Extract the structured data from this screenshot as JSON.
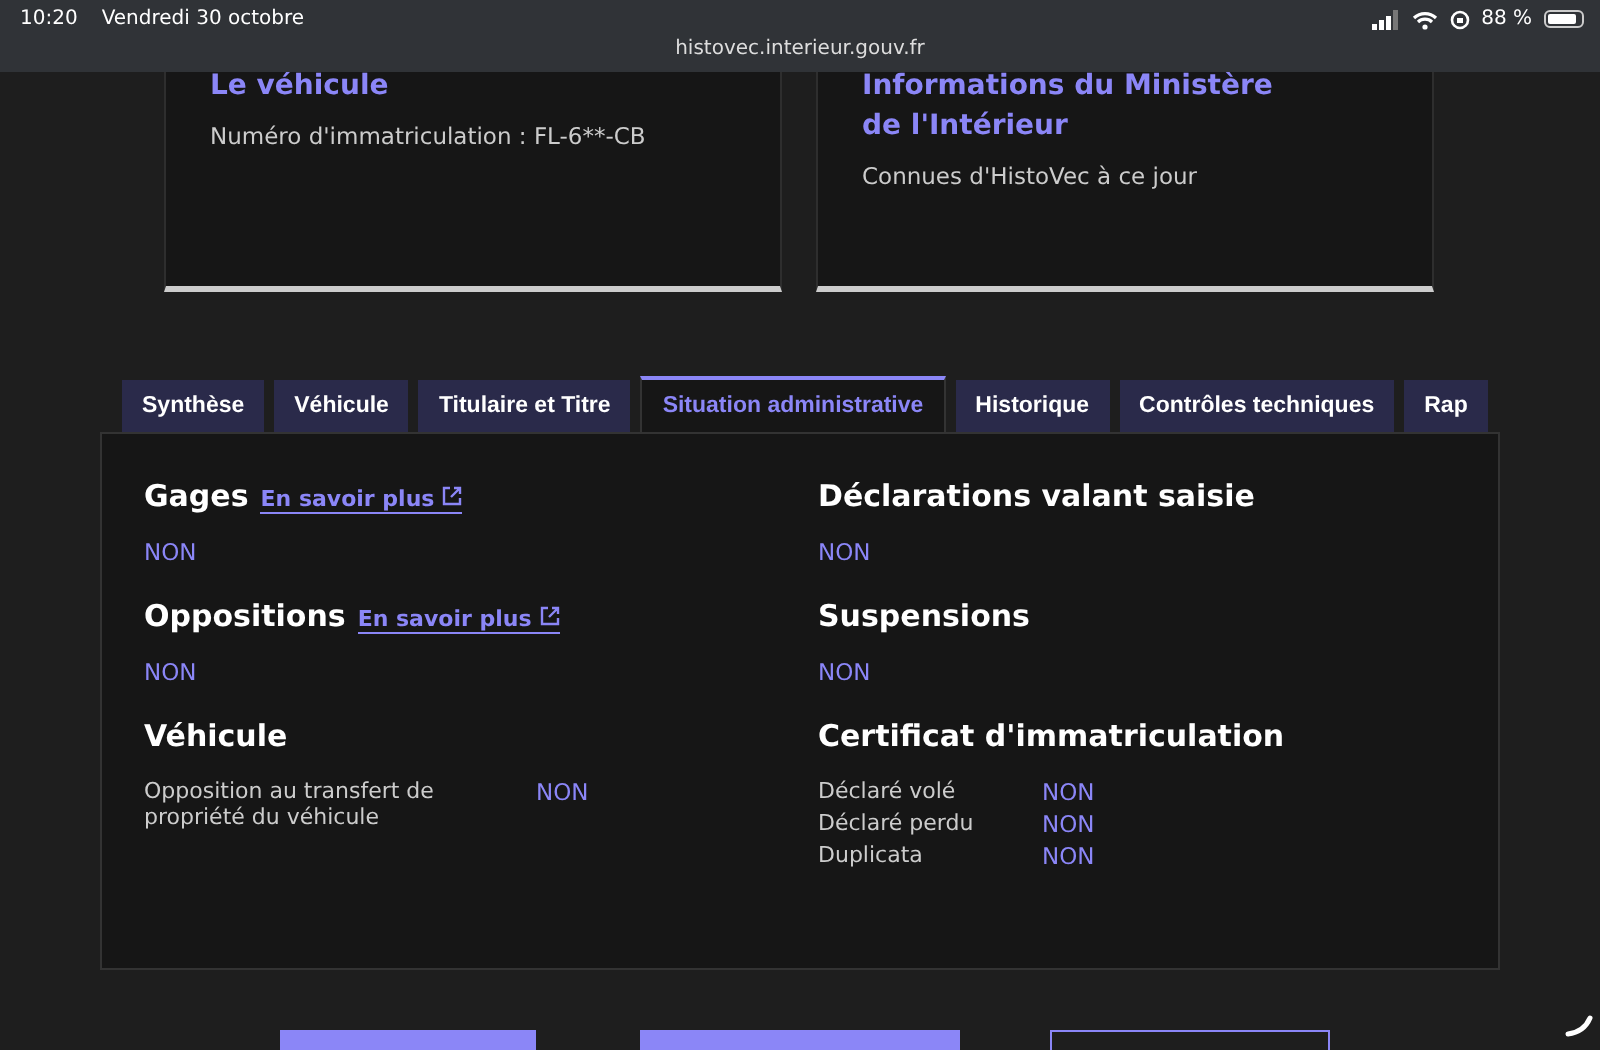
{
  "status_bar": {
    "time": "10:20",
    "date": "Vendredi 30 octobre",
    "url": "histovec.interieur.gouv.fr",
    "battery": "88 %"
  },
  "cards": [
    {
      "title": "Le véhicule",
      "text": "Numéro d'immatriculation : FL-6**-CB"
    },
    {
      "title": "Informations du Ministère de l'Intérieur",
      "text": "Connues d'HistoVec à ce jour"
    }
  ],
  "tabs": [
    {
      "label": "Synthèse",
      "selected": false
    },
    {
      "label": "Véhicule",
      "selected": false
    },
    {
      "label": "Titulaire et Titre",
      "selected": false
    },
    {
      "label": "Situation administrative",
      "selected": true
    },
    {
      "label": "Historique",
      "selected": false
    },
    {
      "label": "Contrôles techniques",
      "selected": false
    },
    {
      "label": "Rap",
      "selected": false
    }
  ],
  "columns": [
    [
      {
        "kind": "simple",
        "title": "Gages",
        "link": "En savoir plus",
        "value": "NON"
      },
      {
        "kind": "simple",
        "title": "Oppositions",
        "link": "En savoir plus",
        "value": "NON"
      },
      {
        "kind": "table",
        "title": "Véhicule",
        "rows": [
          {
            "label": "Opposition au transfert de propriété du véhicule",
            "value": "NON"
          }
        ]
      }
    ],
    [
      {
        "kind": "simple",
        "title": "Déclarations valant saisie",
        "value": "NON"
      },
      {
        "kind": "simple",
        "title": "Suspensions",
        "value": "NON"
      },
      {
        "kind": "table",
        "title": "Certificat d'immatriculation",
        "rows": [
          {
            "label": "Déclaré volé",
            "value": "NON"
          },
          {
            "label": "Déclaré perdu",
            "value": "NON"
          },
          {
            "label": "Duplicata",
            "value": "NON"
          }
        ]
      }
    ]
  ],
  "buttons": [
    {
      "kind": "filled"
    },
    {
      "kind": "filled"
    },
    {
      "kind": "outline"
    }
  ]
}
